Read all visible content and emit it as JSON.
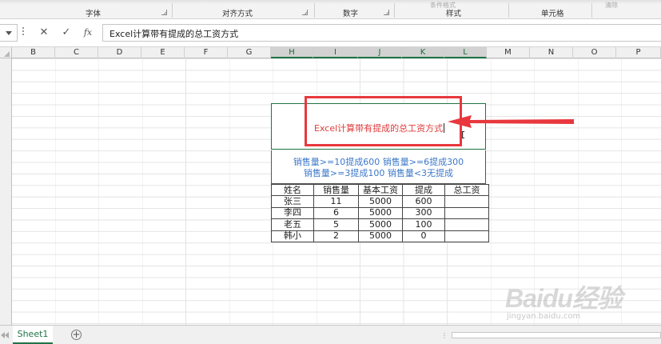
{
  "ribbon": {
    "groups": [
      "字体",
      "对齐方式",
      "数字",
      "样式",
      "单元格"
    ],
    "ghost_labels": [
      "条件格式",
      "清除"
    ]
  },
  "formula_bar": {
    "cancel_symbol": "✕",
    "enter_symbol": "✓",
    "fx_label": "fx",
    "content": "Excel计算带有提成的总工资方式"
  },
  "columns": [
    "B",
    "C",
    "D",
    "E",
    "F",
    "G",
    "H",
    "I",
    "J",
    "K",
    "L",
    "M",
    "N",
    "O",
    "P"
  ],
  "selected_columns": [
    "H",
    "I",
    "J",
    "K",
    "L"
  ],
  "title_cell": {
    "text": "Excel计算带有提成的总工资方式",
    "color": "#e03a3a"
  },
  "rules": {
    "line1": "销售量>=10提成600  销售量>=6提成300",
    "line2": "销售量>=3提成100  销售量<3无提成",
    "color": "#3d78c8"
  },
  "table": {
    "headers": [
      "姓名",
      "销售量",
      "基本工资",
      "提成",
      "总工资"
    ],
    "rows": [
      [
        "张三",
        "11",
        "5000",
        "600",
        ""
      ],
      [
        "李四",
        "6",
        "5000",
        "300",
        ""
      ],
      [
        "老五",
        "5",
        "5000",
        "100",
        ""
      ],
      [
        "韩小",
        "2",
        "5000",
        "0",
        ""
      ]
    ]
  },
  "annotation": {
    "color": "#e8383d"
  },
  "sheet_tabs": {
    "active": "Sheet1",
    "add_symbol": "+"
  },
  "watermark": {
    "logo": "Baidu经验",
    "url": "jingyan.baidu.com"
  },
  "accent_color": "#217346"
}
